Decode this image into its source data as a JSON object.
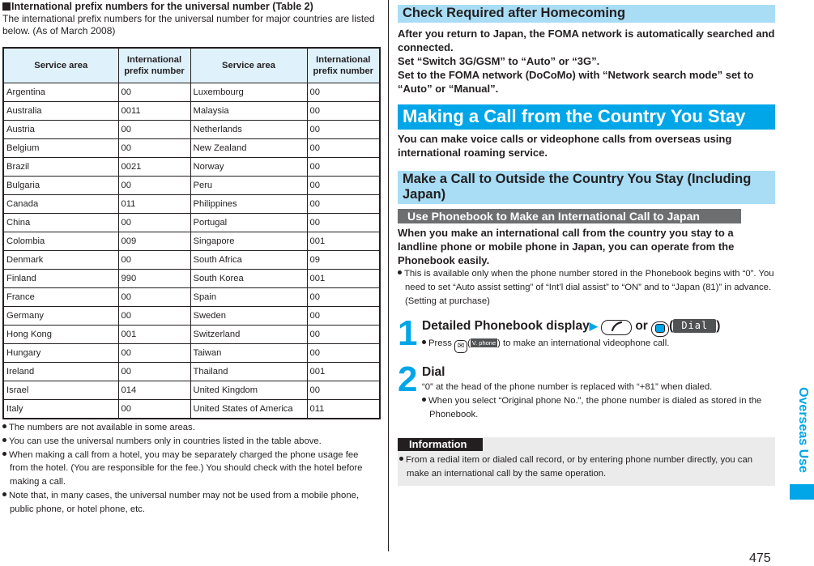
{
  "left": {
    "title": "International prefix numbers for the universal number (Table 2)",
    "intro": "The international prefix numbers for the universal number for major countries are listed below. (As of March 2008)",
    "table": {
      "headers": [
        "Service area",
        "International prefix number",
        "Service area",
        "International prefix number"
      ],
      "rows": [
        [
          "Argentina",
          "00",
          "Luxembourg",
          "00"
        ],
        [
          "Australia",
          "0011",
          "Malaysia",
          "00"
        ],
        [
          "Austria",
          "00",
          "Netherlands",
          "00"
        ],
        [
          "Belgium",
          "00",
          "New Zealand",
          "00"
        ],
        [
          "Brazil",
          "0021",
          "Norway",
          "00"
        ],
        [
          "Bulgaria",
          "00",
          "Peru",
          "00"
        ],
        [
          "Canada",
          "011",
          "Philippines",
          "00"
        ],
        [
          "China",
          "00",
          "Portugal",
          "00"
        ],
        [
          "Colombia",
          "009",
          "Singapore",
          "001"
        ],
        [
          "Denmark",
          "00",
          "South Africa",
          "09"
        ],
        [
          "Finland",
          "990",
          "South Korea",
          "001"
        ],
        [
          "France",
          "00",
          "Spain",
          "00"
        ],
        [
          "Germany",
          "00",
          "Sweden",
          "00"
        ],
        [
          "Hong Kong",
          "001",
          "Switzerland",
          "00"
        ],
        [
          "Hungary",
          "00",
          "Taiwan",
          "00"
        ],
        [
          "Ireland",
          "00",
          "Thailand",
          "001"
        ],
        [
          "Israel",
          "014",
          "United Kingdom",
          "00"
        ],
        [
          "Italy",
          "00",
          "United States of America",
          "011"
        ]
      ]
    },
    "notes": [
      "The numbers are not available in some areas.",
      "You can use the universal numbers only in countries listed in the table above.",
      "When making a call from a hotel, you may be separately charged the phone usage fee from the hotel. (You are responsible for the fee.) You should check with the hotel before making a call.",
      "Note that, in many cases, the universal number may not be used from a mobile phone, public phone, or hotel phone, etc."
    ]
  },
  "right": {
    "check_heading": "Check Required after Homecoming",
    "check_lines": [
      "After you return to Japan, the FOMA network is automatically searched and connected.",
      "Set “Switch 3G/GSM” to “Auto” or “3G”.",
      "Set to the FOMA network (DoCoMo) with “Network search mode” set to “Auto” or “Manual”."
    ],
    "making_heading": "Making a Call from the Country You Stay",
    "making_text": "You can make voice calls or videophone calls from overseas using international roaming service.",
    "outside_heading": "Make a Call to Outside the Country You Stay (Including Japan)",
    "phonebook_heading": "Use Phonebook to Make an International Call to Japan",
    "phonebook_text": "When you make an international call from the country you stay to a landline phone or mobile phone in Japan, you can operate from the Phonebook easily.",
    "phonebook_note": "This is available only when the phone number stored in the Phonebook begins with “0”. You need to set “Auto assist setting” of “Int’l dial assist” to “ON” and to “Japan (81)” in advance. (Setting at purchase)",
    "steps": [
      {
        "num": "1",
        "title": "Detailed Phonebook display",
        "or": "or",
        "softkey": "Dial",
        "note_pre": "Press",
        "note_softkey": "V. phone",
        "note_post": "to make an international videophone call."
      },
      {
        "num": "2",
        "title": "Dial",
        "text": "“0” at the head of the phone number is replaced with “+81” when dialed.",
        "note": "When you select “Original phone No.”, the phone number is dialed as stored in the Phonebook."
      }
    ],
    "info_label": "Information",
    "info_text": "From a redial item or dialed call record, or by entering phone number directly, you can make an international call by the same operation."
  },
  "side_tab": "Overseas Use",
  "page_number": "475",
  "colors": {
    "accent": "#00a6e8",
    "light_heading": "#a8ddf5",
    "table_header": "#dff1fb",
    "gray_heading": "#6d6e70",
    "info_bg": "#ebebeb"
  }
}
